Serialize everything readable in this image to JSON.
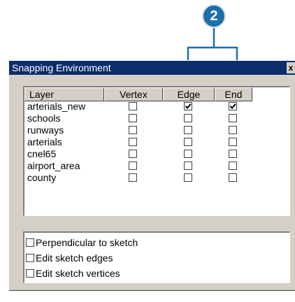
{
  "callout": {
    "number": "2"
  },
  "window": {
    "title": "Snapping Environment",
    "close_glyph": "x"
  },
  "table": {
    "headers": [
      "Layer",
      "Vertex",
      "Edge",
      "End"
    ],
    "rows": [
      {
        "name": "arterials_new",
        "vertex": false,
        "edge": true,
        "end": true
      },
      {
        "name": "schools",
        "vertex": false,
        "edge": false,
        "end": false
      },
      {
        "name": "runways",
        "vertex": false,
        "edge": false,
        "end": false
      },
      {
        "name": "arterials",
        "vertex": false,
        "edge": false,
        "end": false
      },
      {
        "name": "cnel65",
        "vertex": false,
        "edge": false,
        "end": false
      },
      {
        "name": "airport_area",
        "vertex": false,
        "edge": false,
        "end": false
      },
      {
        "name": "county",
        "vertex": false,
        "edge": false,
        "end": false
      }
    ]
  },
  "options": [
    {
      "label": "Perpendicular to sketch",
      "checked": false
    },
    {
      "label": "Edit sketch edges",
      "checked": false
    },
    {
      "label": "Edit sketch vertices",
      "checked": false
    }
  ],
  "colors": {
    "callout": "#1e6ea8",
    "titlebar": "#0b2d6b",
    "dialog": "#d4d0c8"
  }
}
